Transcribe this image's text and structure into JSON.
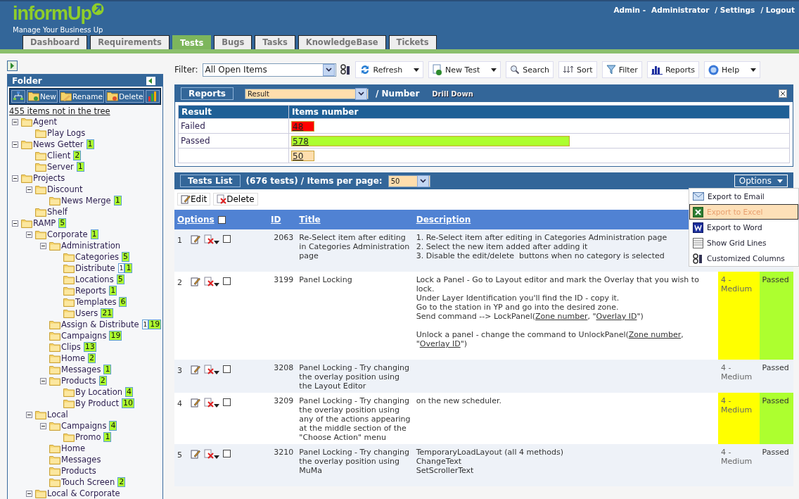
{
  "header": {
    "logo": "informUp",
    "tagline": "Manage Your Business Up",
    "user_label": "Admin -",
    "links": [
      "Administrator",
      "/ Settings",
      "/ Logout"
    ]
  },
  "tabs": [
    {
      "label": "Dashboard",
      "selected": false
    },
    {
      "label": "Requirements",
      "selected": false
    },
    {
      "label": "Tests",
      "selected": true
    },
    {
      "label": "Bugs",
      "selected": false
    },
    {
      "label": "Tasks",
      "selected": false
    },
    {
      "label": "KnowledgeBase",
      "selected": false
    },
    {
      "label": "Tickets",
      "selected": false
    }
  ],
  "folder_panel": {
    "title": "Folder",
    "toolbar": [
      {
        "kind": "add-node"
      },
      {
        "kind": "new",
        "label": "New"
      },
      {
        "kind": "rename",
        "label": "Rename"
      },
      {
        "kind": "delete",
        "label": "Delete"
      },
      {
        "kind": "chart"
      }
    ],
    "unsorted_link": "455 items not in the tree",
    "tree": [
      {
        "label": "Agent",
        "expanded": true,
        "children": [
          {
            "label": "Play Logs"
          }
        ]
      },
      {
        "label": "News Getter",
        "count": "1",
        "expanded": true,
        "children": [
          {
            "label": "Client",
            "count": "2"
          },
          {
            "label": "Server",
            "count": "1"
          }
        ]
      },
      {
        "label": "Projects",
        "expanded": true,
        "children": [
          {
            "label": "Discount",
            "expanded": true,
            "children": [
              {
                "label": "News Merge",
                "count": "1"
              }
            ]
          },
          {
            "label": "Shelf"
          }
        ]
      },
      {
        "label": "RAMP",
        "count": "5",
        "expanded": true,
        "children": [
          {
            "label": "Corporate",
            "count": "1",
            "expanded": true,
            "children": [
              {
                "label": "Administration",
                "expanded": true,
                "children": [
                  {
                    "label": "Categories",
                    "count": "5"
                  },
                  {
                    "label": "Distribute",
                    "new_count": "1",
                    "count": "1"
                  },
                  {
                    "label": "Locations",
                    "count": "5"
                  },
                  {
                    "label": "Reports",
                    "count": "1"
                  },
                  {
                    "label": "Templates",
                    "count": "6"
                  },
                  {
                    "label": "Users",
                    "count": "21"
                  }
                ]
              },
              {
                "label": "Assign & Distribute",
                "new_count": "1",
                "count": "19"
              },
              {
                "label": "Campaigns",
                "count": "19"
              },
              {
                "label": "Clips",
                "count": "13"
              },
              {
                "label": "Home",
                "count": "2"
              },
              {
                "label": "Messages",
                "count": "1"
              },
              {
                "label": "Products",
                "count": "2",
                "expanded": true,
                "children": [
                  {
                    "label": "By Location",
                    "count": "4"
                  },
                  {
                    "label": "By Product",
                    "count": "10"
                  }
                ]
              }
            ]
          },
          {
            "label": "Local",
            "expanded": true,
            "children": [
              {
                "label": "Campaigns",
                "count": "4",
                "expanded": true,
                "children": [
                  {
                    "label": "Promo",
                    "count": "1"
                  }
                ]
              },
              {
                "label": "Home"
              },
              {
                "label": "Messages"
              },
              {
                "label": "Products"
              },
              {
                "label": "Touch Screen",
                "count": "2"
              }
            ]
          },
          {
            "label": "Local & Corporate",
            "expanded": true
          }
        ]
      }
    ]
  },
  "toolbar": {
    "filter_label": "Filter:",
    "filter_value": "All Open Items",
    "buttons": [
      {
        "label": "Refresh",
        "kind": "refresh",
        "dropdown": true
      },
      {
        "label": "New Test",
        "kind": "new",
        "dropdown": true
      },
      {
        "label": "Search",
        "kind": "search",
        "dropdown": false
      },
      {
        "label": "Sort",
        "kind": "sort",
        "dropdown": false
      },
      {
        "label": "Filter",
        "kind": "filter",
        "dropdown": false
      },
      {
        "label": "Reports",
        "kind": "reports",
        "dropdown": false
      },
      {
        "label": "Help",
        "kind": "help",
        "dropdown": true
      }
    ]
  },
  "reports": {
    "tab": "Reports",
    "field": "Result",
    "suffix": "/ Number",
    "drill_down": "Drill Down",
    "columns": [
      "Result",
      "Items number"
    ],
    "rows": [
      {
        "label": "Failed",
        "value": "48",
        "level": 0.047,
        "color": "#ff0000"
      },
      {
        "label": "Passed",
        "value": "578",
        "level": 0.561,
        "color": "#adff2f"
      },
      {
        "value": "50",
        "level": 0.047,
        "color": "#ffdead"
      }
    ]
  },
  "tests_list": {
    "tab": "Tests List",
    "summary": "(676 tests) / Items per page:",
    "per_page": "50",
    "options": "Options",
    "actions": [
      {
        "label": "Edit",
        "kind": "edit"
      },
      {
        "label": "Delete",
        "kind": "delete"
      }
    ],
    "columns": [
      "Options",
      "ID",
      "Title",
      "Description"
    ],
    "all_checked": false,
    "rows": [
      {
        "number": "1",
        "checked": false,
        "id": "2063",
        "title": "Re-Select item after editing in Categories Administration page",
        "description": [
          [
            [
              "1. Re-Select item after editing in Categories Administration page"
            ],
            [
              "2. Select the new item added after adding it"
            ],
            [
              "3. Disable the edit/delete  buttons when no category is selected"
            ]
          ]
        ]
      },
      {
        "number": "2",
        "checked": false,
        "id": "3199",
        "title": "Panel Locking",
        "description": [
          [
            [
              "Lock a Panel - Go to Layout editor and mark the Overlay that you wish to lock."
            ],
            [
              "Under Layer Identification you'll find the ID - copy it."
            ],
            [
              "Go to the station in YP and go into the desired zone."
            ],
            [
              "Send command --> LockPanel(",
              {
                "link": "Zone number"
              },
              ", \"",
              {
                "link": "Overlay ID"
              },
              "\")"
            ]
          ],
          [
            [
              "Unlock a panel - change the command to UnlockPanel(",
              {
                "link": "Zone number"
              },
              ", \"",
              {
                "link": "Overlay ID"
              },
              "\")"
            ]
          ]
        ],
        "priority": "4 - Medium",
        "status": "Passed"
      },
      {
        "number": "3",
        "checked": false,
        "id": "3208",
        "title": "Panel Locking - Try changing the overlay position using the Layout Editor",
        "description": [],
        "priority": "4 - Medium",
        "status": "Passed"
      },
      {
        "number": "4",
        "checked": false,
        "id": "3209",
        "title": "Panel Locking - Try changing the overlay position using any of the actions appearing at the middle section of the \"Choose Action\" menu",
        "description": [
          [
            [
              "on the new scheduler."
            ]
          ]
        ],
        "priority": "4 - Medium",
        "status": "Passed"
      },
      {
        "number": "5",
        "checked": false,
        "id": "3210",
        "title": "Panel Locking - Try changing the overlay position using MuMa",
        "description": [
          [
            [
              "TemporaryLoadLayout (all 4 methods)"
            ],
            [
              "ChangeText"
            ],
            [
              "SetScrollerText"
            ]
          ]
        ],
        "priority": "4 - Medium",
        "status": "Passed"
      }
    ]
  },
  "options_menu": [
    {
      "label": "Export to Email",
      "kind": "email",
      "highlighted": false
    },
    {
      "label": "Export to Excel",
      "kind": "excel",
      "highlighted": true
    },
    {
      "label": "Export to Word",
      "kind": "word",
      "highlighted": false
    },
    {
      "label": "Show Grid Lines",
      "kind": "grid",
      "highlighted": false
    },
    {
      "label": "Customized Columns",
      "kind": "columns",
      "highlighted": false
    }
  ]
}
